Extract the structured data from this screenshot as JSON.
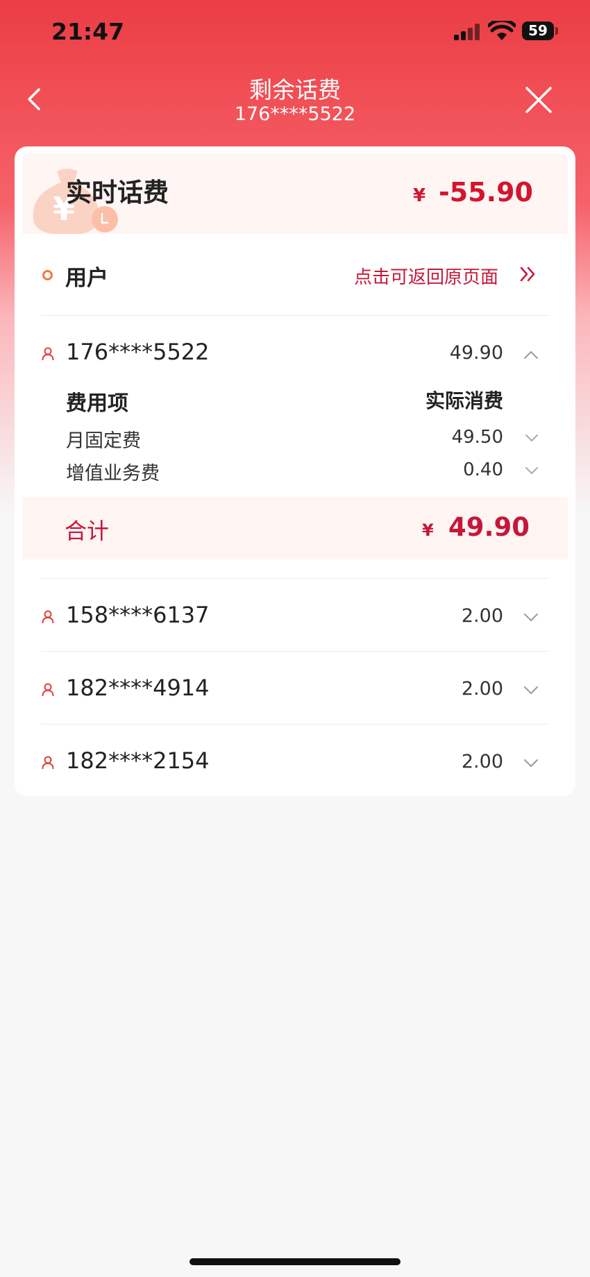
{
  "status_bar": {
    "time": "21:47",
    "battery": "59"
  },
  "nav": {
    "title": "剩余话费",
    "subtitle": "176****5522"
  },
  "summary": {
    "title": "实时话费",
    "currency": "¥",
    "amount": "-55.90"
  },
  "users_header": {
    "label": "用户",
    "return_link": "点击可返回原页面"
  },
  "users": [
    {
      "phone": "176****5522",
      "amount": "49.90",
      "expanded": true,
      "fees_header": {
        "item": "费用项",
        "actual": "实际消费"
      },
      "fees": [
        {
          "name": "月固定费",
          "value": "49.50"
        },
        {
          "name": "增值业务费",
          "value": "0.40"
        }
      ],
      "total": {
        "label": "合计",
        "currency": "¥",
        "amount": "49.90"
      }
    },
    {
      "phone": "158****6137",
      "amount": "2.00",
      "expanded": false
    },
    {
      "phone": "182****4914",
      "amount": "2.00",
      "expanded": false
    },
    {
      "phone": "182****2154",
      "amount": "2.00",
      "expanded": false
    }
  ],
  "colors": {
    "accent": "#c6173a",
    "amount_red": "#d3152e",
    "header_red": "#ea3d44"
  }
}
